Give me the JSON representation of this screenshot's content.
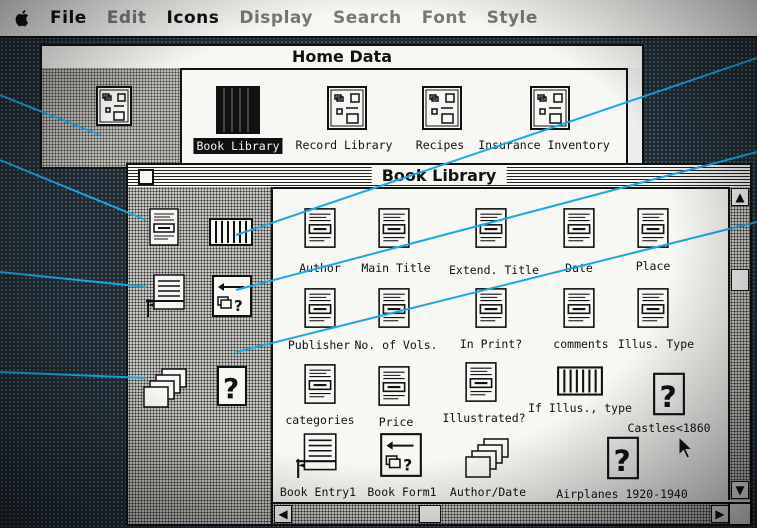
{
  "menubar": {
    "items": [
      {
        "label": "File",
        "enabled": true
      },
      {
        "label": "Edit",
        "enabled": false
      },
      {
        "label": "Icons",
        "enabled": true
      },
      {
        "label": "Display",
        "enabled": false
      },
      {
        "label": "Search",
        "enabled": false
      },
      {
        "label": "Font",
        "enabled": false
      },
      {
        "label": "Style",
        "enabled": false
      }
    ]
  },
  "home_window": {
    "title": "Home Data",
    "items": [
      {
        "label": "Book Library",
        "icon": "file-cabinet-icon",
        "selected": true
      },
      {
        "label": "Record Library",
        "icon": "form-stack-icon",
        "selected": false
      },
      {
        "label": "Recipes",
        "icon": "form-stack-icon",
        "selected": false
      },
      {
        "label": "Insurance Inventory",
        "icon": "form-stack-icon",
        "selected": false
      }
    ]
  },
  "book_window": {
    "title": "Book Library",
    "fields": [
      {
        "label": "Author"
      },
      {
        "label": "Main Title"
      },
      {
        "label": "Extend. Title"
      },
      {
        "label": "Date"
      },
      {
        "label": "Place"
      },
      {
        "label": "Publisher"
      },
      {
        "label": "No. of Vols."
      },
      {
        "label": "In Print?"
      },
      {
        "label": "comments"
      },
      {
        "label": "Illus. Type"
      },
      {
        "label": "categories"
      },
      {
        "label": "Price"
      },
      {
        "label": "Illustrated?"
      },
      {
        "label": "If Illus., type"
      },
      {
        "label": "Castles<1860"
      },
      {
        "label": "Book Entry1"
      },
      {
        "label": "Book Form1"
      },
      {
        "label": "Author/Date"
      },
      {
        "label": "Airplanes 1920-1940"
      }
    ]
  },
  "palette_icons": [
    "field-icon",
    "file-cabinet-icon",
    "entry-form-icon",
    "form-layout-icon",
    "report-stack-icon",
    "query-icon"
  ],
  "colors": {
    "callout_line": "#1aa7e8",
    "menubar_bg": "#f6f6f3",
    "desktop_bg": "#1f2a33"
  }
}
